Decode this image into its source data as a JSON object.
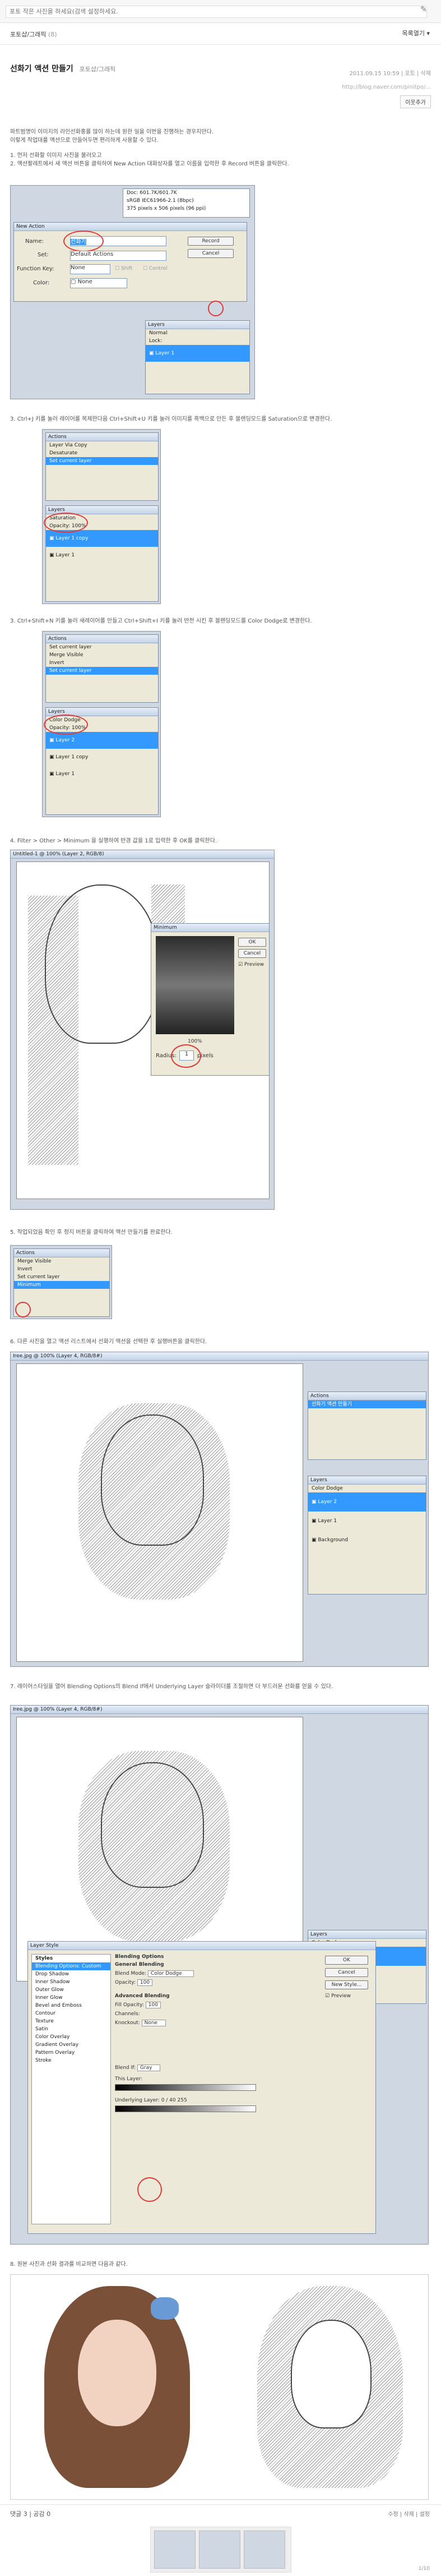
{
  "search": {
    "placeholder": "포토 작은 사진을 하세요(검색 설정하세요."
  },
  "header": {
    "crumb": "포토샵/그래픽",
    "count": "(8)",
    "list_btn": "목록열기 ▾"
  },
  "post": {
    "title": "선화기 액션 만들기",
    "category": "포토샵/그래픽",
    "meta": "2011.09.15 10:59 | 포토 | 삭제",
    "url": "http://blog.naver.com/pinitpo/...",
    "add_btn": "이웃추가"
  },
  "paras": {
    "p1": "파트범명이 이미지의 라인선화홍를 많이 하는데 원한 일을 이번을 진행하는 경우지만다.",
    "p2": "이렇게 작업대를 액션으로 만들어두면 편리하게 사용할 수 있다.",
    "p3": "1. 먼저 선화할 이미지 사진을 불러오고",
    "p4": "2. 액션팔레트에서 새 액션 버튼을 클릭하여 New Action 대화상자를 열고 이름을 입력한 후 Record 버튼을 클릭한다.",
    "p5": "3. Ctrl+J 키를 눌러 레이어를 복제한다음 Ctrl+Shift+U 키를 눌러 이미지를 흑백으로 만든 후 블렌딩모드를 Saturation으로 변경한다.",
    "p6": "3. Ctrl+Shift+N 키를 눌러 새레이어를 만들고 Ctrl+Shift+I 키를 눌러 반전 시킨 후 블렌딩모드를 Color Dodge로 변경한다.",
    "p7": "4. Filter > Other > Minimum 을 실행하여 반경 값을 1로 입력한 후 OK를 클릭한다.",
    "p8": "5. 작업되었음 확인 후 정지 버튼을 클릭하여 액션 만들기를 완료한다.",
    "p9": "6. 다른 사진을 열고 액션 리스트에서 선화기 액션을 선택한 후 실행버튼을 클릭한다.",
    "p10": "7. 레이어스타일을 열어 Blending Options의 Blend If에서 Underlying Layer 슬라이더를 조절하면 더 부드러운 선화를 얻을 수 있다.",
    "p11": "8. 원본 사진과 선화 결과를 비교하면 다음과 같다."
  },
  "dialog_new_action": {
    "title": "New Action",
    "name_label": "Name:",
    "name_value": "선화기",
    "set_label": "Set:",
    "set_value": "Default Actions",
    "fkey_label": "Function Key:",
    "fkey_value": "None",
    "shift": "Shift",
    "control": "Control",
    "color_label": "Color:",
    "color_value": "None",
    "record": "Record",
    "cancel": "Cancel"
  },
  "doc_info": {
    "l1": "Doc: 601.7K/601.7K",
    "l2": "sRGB IEC61966-2.1 (8bpc)",
    "l3": "375 pixels x 506 pixels (96 ppi)"
  },
  "layers_panel": {
    "title": "Layers",
    "normal": "Normal",
    "saturation": "Saturation",
    "color_dodge": "Color Dodge",
    "opacity": "Opacity: 100%",
    "fill": "Fill: 100%",
    "lock": "Lock:",
    "layer1": "Layer 1",
    "layer1copy": "Layer 1 copy",
    "layer2": "Layer 2",
    "background": "Background"
  },
  "actions_panel": {
    "title": "Actions",
    "items": [
      "Layer Via Copy",
      "Desaturate",
      "Set current layer",
      "Invert",
      "Merge Visible",
      "Minimum"
    ]
  },
  "minimum_dialog": {
    "title": "Minimum",
    "ok": "OK",
    "cancel": "Cancel",
    "preview": "Preview",
    "zoom": "100%",
    "radius_label": "Radius:",
    "radius_value": "1",
    "unit": "pixels"
  },
  "doc_title1": "Untitled-1 @ 100% (Layer 2, RGB/8)",
  "doc_title2": "Iree.jpg @ 100% (Layer 4, RGB/8#)",
  "doc_title3": "Iree.jpg @ 100% (Layer 4, RGB/8#)",
  "layer_style": {
    "title": "Layer Style",
    "styles_header": "Styles",
    "items": [
      "Blending Options: Custom",
      "Drop Shadow",
      "Inner Shadow",
      "Outer Glow",
      "Inner Glow",
      "Bevel and Emboss",
      "Contour",
      "Texture",
      "Satin",
      "Color Overlay",
      "Gradient Overlay",
      "Pattern Overlay",
      "Stroke"
    ],
    "blending_title": "Blending Options",
    "general": "General Blending",
    "blend_mode": "Blend Mode:",
    "blend_mode_val": "Color Dodge",
    "opacity": "Opacity:",
    "opacity_val": "100",
    "advanced": "Advanced Blending",
    "fill_opacity": "Fill Opacity:",
    "fill_val": "100",
    "channels": "Channels:",
    "knockout": "Knockout:",
    "knockout_val": "None",
    "blend_if": "Blend If:",
    "blend_if_val": "Gray",
    "this_layer": "This Layer:",
    "underlying": "Underlying Layer:",
    "underlying_vals": "0 / 40   255",
    "ok": "OK",
    "cancel": "Cancel",
    "new_style": "New Style...",
    "preview": "Preview"
  },
  "comment": {
    "label": "댓글 3 | 공감 0",
    "share": "수정 | 삭제 | 설정"
  },
  "pager": "1/10"
}
